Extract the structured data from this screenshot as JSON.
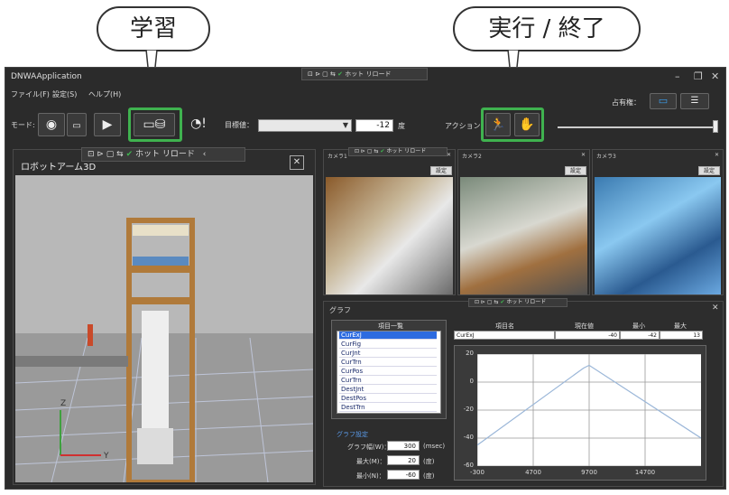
{
  "callouts": {
    "learn": "学習",
    "run_stop": "実行 / 終了"
  },
  "floating_toolbar": {
    "hot_reload": "ホット リロード"
  },
  "window": {
    "title": "DNWAApplication",
    "minimize": "–",
    "restore": "❐",
    "close": "✕"
  },
  "menu": {
    "file": "ファイル(F)",
    "settings": "設定(S)",
    "help": "ヘルプ(H)"
  },
  "toolbar": {
    "mode_label": "モード:",
    "target_label": "目標値：",
    "target_value": "-12",
    "target_unit": "度",
    "action_label": "アクション：",
    "occupancy_label": "占有権："
  },
  "robot3d": {
    "title": "ロボットアーム3D",
    "close": "✕",
    "axis_z": "Z",
    "axis_y": "Y"
  },
  "cameras": [
    {
      "title": "カメラ1",
      "button": "設定",
      "close": "✕"
    },
    {
      "title": "カメラ2",
      "button": "設定",
      "close": "✕"
    },
    {
      "title": "カメラ3",
      "button": "設定",
      "close": "✕"
    }
  ],
  "graph": {
    "title": "グラフ",
    "close": "✕",
    "list_header": "項目一覧",
    "items": [
      "CurExJ",
      "CurFig",
      "CurJnt",
      "CurTrn",
      "CurPos",
      "CurTrn",
      "DestJnt",
      "DestPos",
      "DestTrn"
    ],
    "table_headers": {
      "name": "項目名",
      "current": "現在値",
      "min": "最小",
      "max": "最大"
    },
    "table_row": {
      "name": "CurExJ",
      "current": "-40",
      "min": "-42",
      "max": "13"
    },
    "settings_title": "グラフ設定",
    "settings": [
      {
        "label": "グラフ幅(W)：",
        "value": "300",
        "unit": "(msec)"
      },
      {
        "label": "最大(M)：",
        "value": "20",
        "unit": "(度)"
      },
      {
        "label": "最小(N)：",
        "value": "-60",
        "unit": "(度)"
      }
    ]
  },
  "chart_data": {
    "type": "line",
    "x": [
      -300,
      9200,
      9700,
      19700
    ],
    "series": [
      {
        "values": [
          -45,
          10,
          12,
          -40
        ]
      }
    ],
    "xticks": [
      "-300",
      "4700",
      "9700",
      "14700"
    ],
    "yticks": [
      "20",
      "0",
      "-20",
      "-40",
      "-60"
    ],
    "xlim": [
      -300,
      19700
    ],
    "ylim": [
      -60,
      20
    ],
    "grid": true,
    "line_color": "#9ab6d8"
  }
}
